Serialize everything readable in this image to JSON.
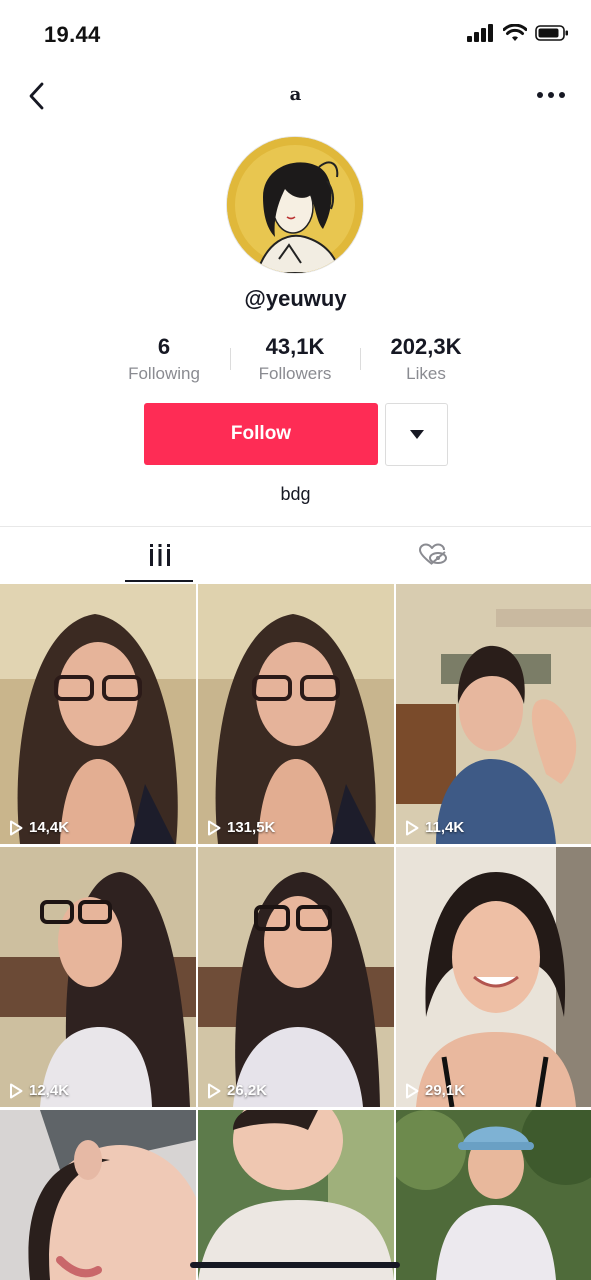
{
  "status_bar": {
    "time": "19.44"
  },
  "nav": {
    "title": "a"
  },
  "profile": {
    "username": "@yeuwuy",
    "bio": "bdg",
    "stats": [
      {
        "value": "6",
        "label": "Following"
      },
      {
        "value": "43,1K",
        "label": "Followers"
      },
      {
        "value": "202,3K",
        "label": "Likes"
      }
    ],
    "follow_label": "Follow"
  },
  "colors": {
    "accent": "#fe2c55",
    "text": "#161823",
    "muted": "#8a8b91"
  },
  "tabs": [
    {
      "icon": "videos-grid-icon",
      "active": true
    },
    {
      "icon": "liked-videos-icon",
      "active": false
    }
  ],
  "videos": [
    {
      "views": "14,4K"
    },
    {
      "views": "131,5K"
    },
    {
      "views": "11,4K"
    },
    {
      "views": "12,4K"
    },
    {
      "views": "26,2K"
    },
    {
      "views": "29,1K"
    },
    {
      "views": ""
    },
    {
      "views": ""
    },
    {
      "views": ""
    }
  ]
}
